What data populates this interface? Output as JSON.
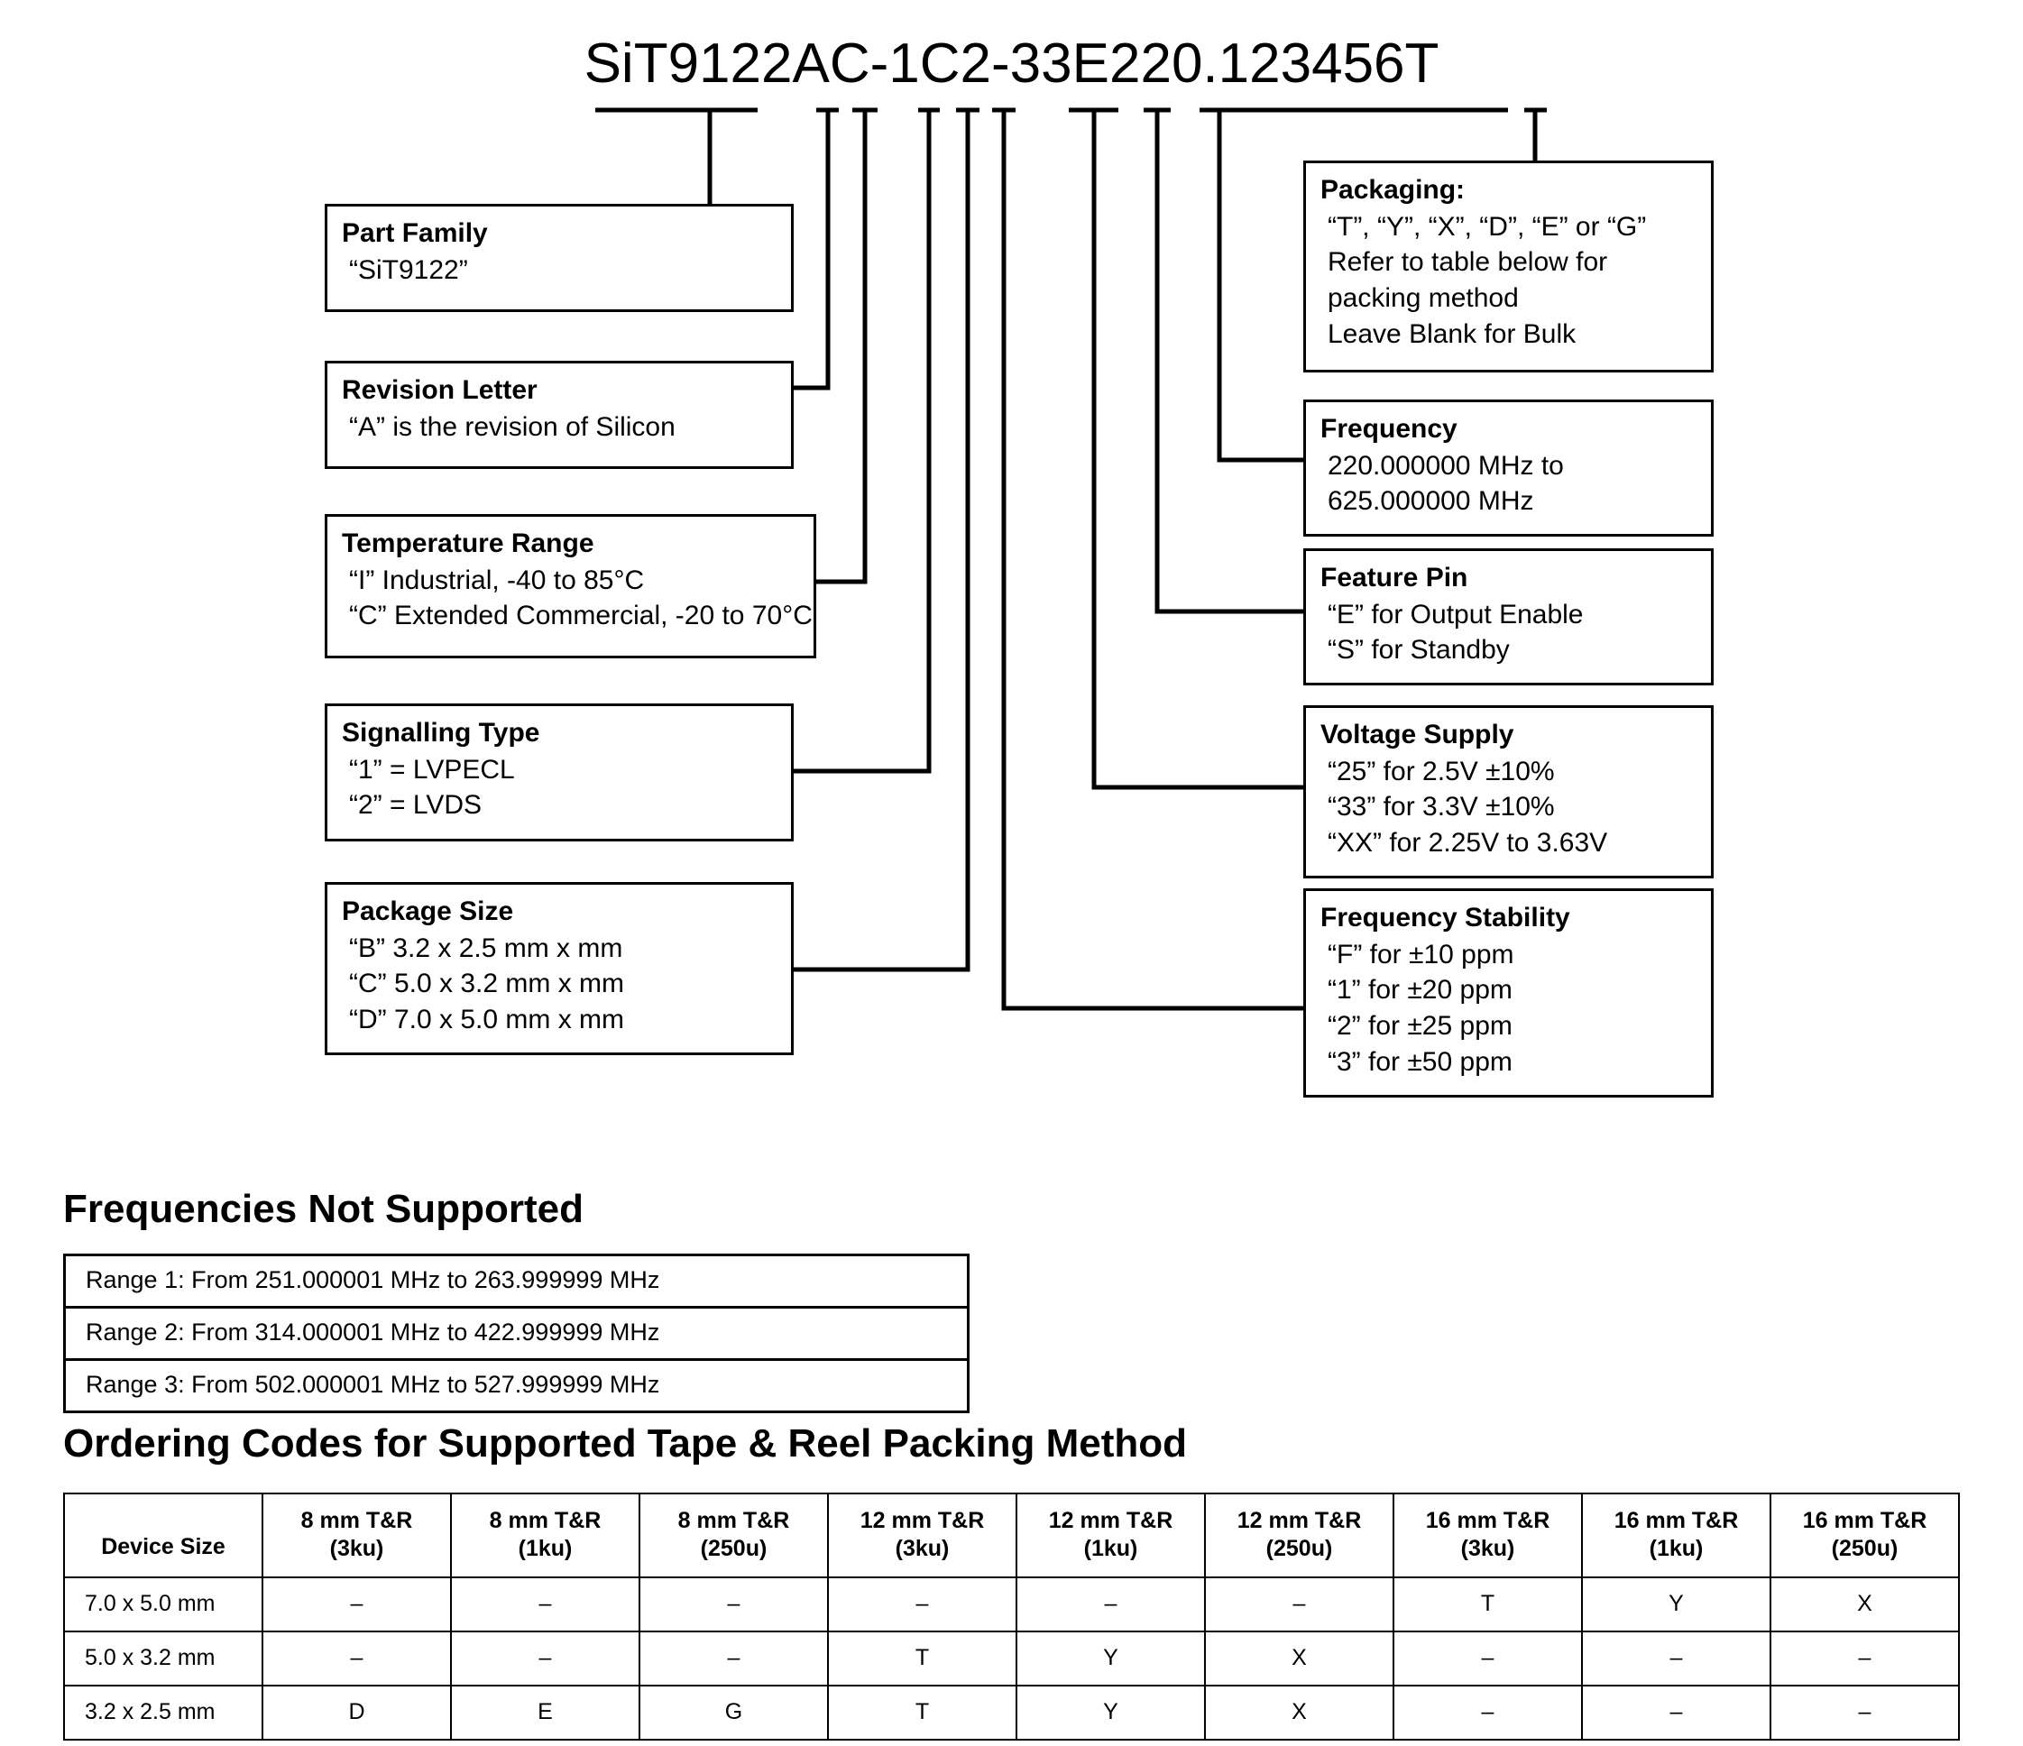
{
  "part_number": "SiT9122AC-1C2-33E220.123456T",
  "callouts": {
    "part_family": {
      "title": "Part Family",
      "lines": [
        "“SiT9122”"
      ]
    },
    "revision_letter": {
      "title": "Revision Letter",
      "lines": [
        "“A” is the revision of Silicon"
      ]
    },
    "temperature_range": {
      "title": "Temperature Range",
      "lines": [
        "“I” Industrial, -40 to 85°C",
        "“C” Extended Commercial, -20 to 70°C"
      ]
    },
    "signalling_type": {
      "title": "Signalling Type",
      "lines": [
        "“1” = LVPECL",
        "“2” = LVDS"
      ]
    },
    "package_size": {
      "title": "Package Size",
      "lines": [
        "“B”  3.2 x 2.5  mm x mm",
        "“C”  5.0 x 3.2 mm x mm",
        "“D”  7.0 x 5.0 mm x mm"
      ]
    },
    "packaging": {
      "title": "Packaging:",
      "lines": [
        "“T”, “Y”, “X”, “D”, “E” or “G”",
        "Refer to table below for",
        "packing method",
        "Leave Blank  for Bulk"
      ]
    },
    "frequency": {
      "title": "Frequency",
      "lines": [
        "220.000000 MHz to",
        "625.000000 MHz"
      ]
    },
    "feature_pin": {
      "title": "Feature Pin",
      "lines": [
        "“E” for Output Enable",
        "“S” for Standby"
      ]
    },
    "voltage_supply": {
      "title": "Voltage Supply",
      "lines": [
        "“25” for 2.5V ±10%",
        "“33” for 3.3V ±10%",
        "“XX” for 2.25V to 3.63V"
      ]
    },
    "frequency_stability": {
      "title": "Frequency Stability",
      "lines": [
        "“F” for ±10 ppm",
        "“1” for ±20 ppm",
        "“2” for ±25 ppm",
        "“3” for ±50 ppm"
      ]
    }
  },
  "frequencies_not_supported": {
    "heading": "Frequencies Not Supported",
    "rows": [
      "Range 1: From 251.000001 MHz to 263.999999 MHz",
      "Range 2: From 314.000001 MHz to 422.999999 MHz",
      "Range 3: From 502.000001 MHz to 527.999999 MHz"
    ]
  },
  "ordering_codes": {
    "heading": "Ordering Codes for Supported Tape & Reel Packing Method",
    "columns": [
      {
        "l1": "",
        "l2": "Device Size"
      },
      {
        "l1": "8 mm T&R",
        "l2": "(3ku)"
      },
      {
        "l1": "8 mm T&R",
        "l2": "(1ku)"
      },
      {
        "l1": "8 mm T&R",
        "l2": "(250u)"
      },
      {
        "l1": "12 mm T&R",
        "l2": "(3ku)"
      },
      {
        "l1": "12 mm T&R",
        "l2": "(1ku)"
      },
      {
        "l1": "12 mm T&R",
        "l2": "(250u)"
      },
      {
        "l1": "16 mm T&R",
        "l2": "(3ku)"
      },
      {
        "l1": "16 mm T&R",
        "l2": "(1ku)"
      },
      {
        "l1": "16 mm T&R",
        "l2": "(250u)"
      }
    ],
    "rows": [
      {
        "device_size": "7.0 x 5.0 mm",
        "codes": [
          "–",
          "–",
          "–",
          "–",
          "–",
          "–",
          "T",
          "Y",
          "X"
        ]
      },
      {
        "device_size": "5.0 x 3.2 mm",
        "codes": [
          "–",
          "–",
          "–",
          "T",
          "Y",
          "X",
          "–",
          "–",
          "–"
        ]
      },
      {
        "device_size": "3.2 x 2.5 mm",
        "codes": [
          "D",
          "E",
          "G",
          "T",
          "Y",
          "X",
          "–",
          "–",
          "–"
        ]
      }
    ]
  },
  "colors": {
    "line": "#000000",
    "background": "#ffffff"
  }
}
